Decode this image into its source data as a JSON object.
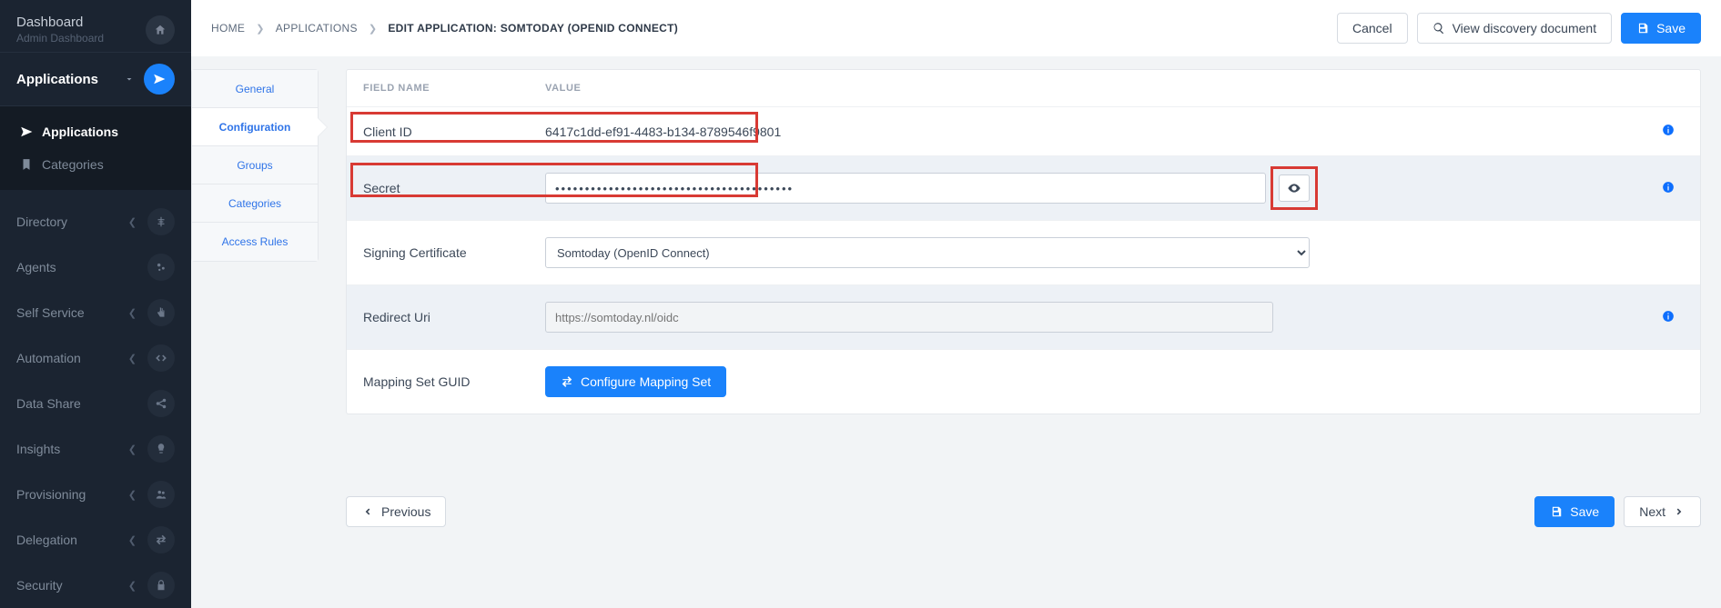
{
  "sidebar": {
    "dashboard": "Dashboard",
    "dashboard_sub": "Admin Dashboard",
    "applications": "Applications",
    "sub_applications": "Applications",
    "sub_categories": "Categories",
    "items": [
      {
        "label": "Directory"
      },
      {
        "label": "Agents"
      },
      {
        "label": "Self Service"
      },
      {
        "label": "Automation"
      },
      {
        "label": "Data Share"
      },
      {
        "label": "Insights"
      },
      {
        "label": "Provisioning"
      },
      {
        "label": "Delegation"
      },
      {
        "label": "Security"
      }
    ]
  },
  "breadcrumbs": {
    "home": "HOME",
    "apps": "APPLICATIONS",
    "edit": "EDIT APPLICATION: SOMTODAY (OPENID CONNECT)"
  },
  "topActions": {
    "cancel": "Cancel",
    "view_discovery": "View discovery document",
    "save": "Save"
  },
  "subnav": {
    "general": "General",
    "configuration": "Configuration",
    "groups": "Groups",
    "categories": "Categories",
    "access_rules": "Access Rules"
  },
  "table": {
    "field_name": "FIELD NAME",
    "value": "VALUE",
    "client_id_label": "Client ID",
    "client_id_value": "6417c1dd-ef91-4483-b134-8789546f9801",
    "secret_label": "Secret",
    "secret_value": "••••••••••••••••••••••••••••••••••••••••",
    "signing_cert_label": "Signing Certificate",
    "signing_cert_value": "Somtoday (OpenID Connect)",
    "redirect_label": "Redirect Uri",
    "redirect_placeholder": "https://somtoday.nl/oidc",
    "mapping_label": "Mapping Set GUID",
    "mapping_button": "Configure Mapping Set"
  },
  "footer": {
    "previous": "Previous",
    "save": "Save",
    "next": "Next"
  }
}
